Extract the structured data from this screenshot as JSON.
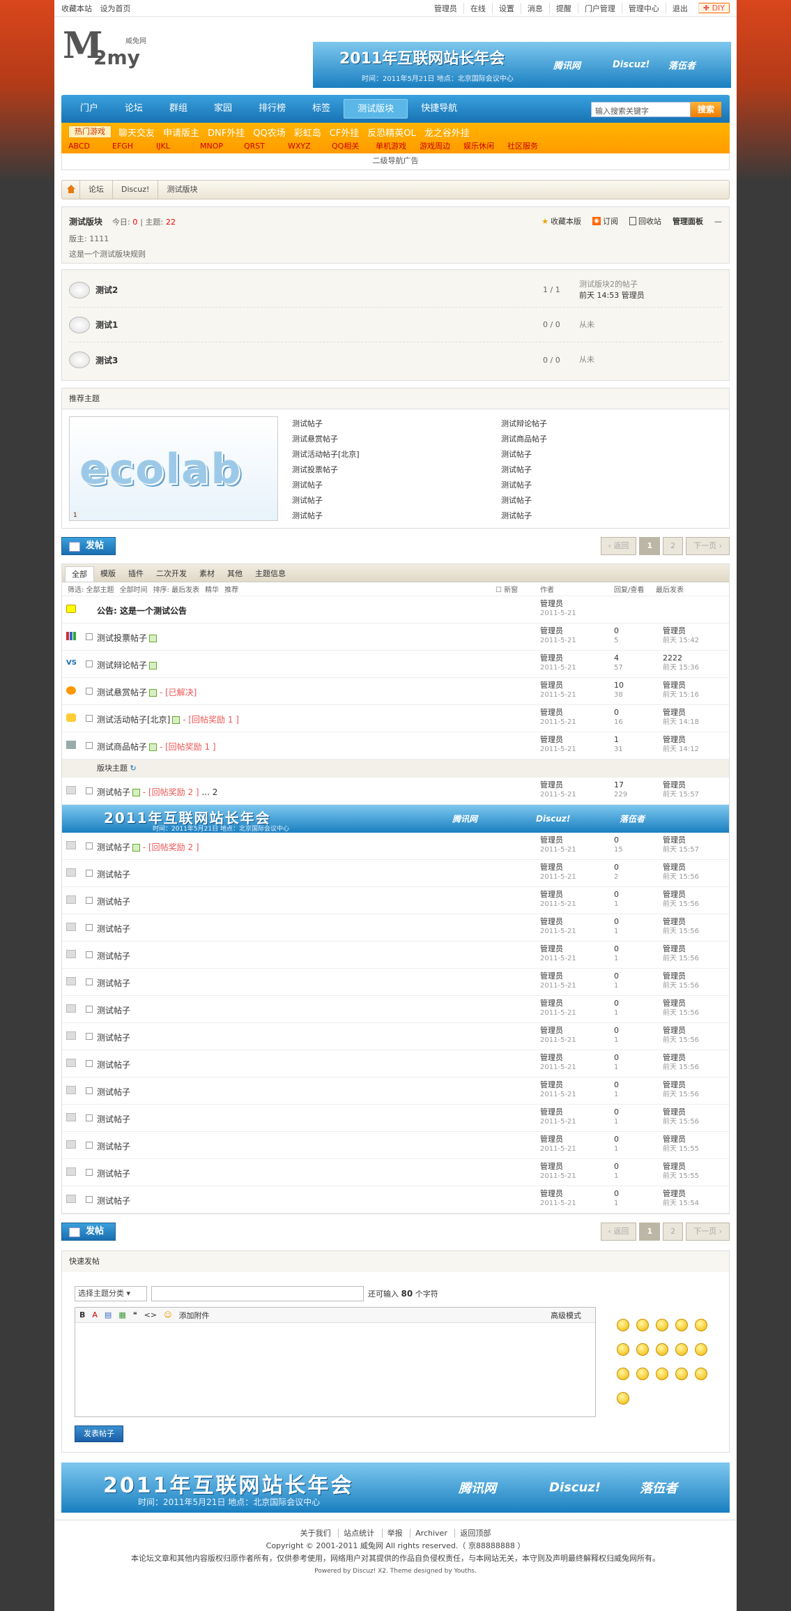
{
  "topbar": {
    "left": [
      "收藏本站",
      "设为首页"
    ],
    "right": [
      "管理员",
      "在线",
      "设置",
      "消息",
      "提醒",
      "门户管理",
      "管理中心",
      "退出"
    ],
    "diy": "DIY"
  },
  "logo": {
    "text": "2my",
    "sub": "威兔网"
  },
  "header_banner": {
    "title": "2011年互联网站长年会",
    "subtitle": "时间：2011年5月21日    地点：北京国际会议中心",
    "logos": [
      "腾讯网",
      "Discuz!",
      "落伍者"
    ]
  },
  "nav": {
    "items": [
      "门户",
      "论坛",
      "群组",
      "家园",
      "排行榜",
      "标签",
      "测试版块",
      "快捷导航"
    ],
    "active_index": 6,
    "search_placeholder": "输入搜索关键字",
    "search_button": "搜索"
  },
  "hotgames": {
    "label": "热门游戏",
    "links": [
      "聊天交友",
      "申请版主",
      "DNF外挂",
      "QQ农场",
      "彩虹岛",
      "CF外挂",
      "反恐精英OL",
      "龙之谷外挂"
    ],
    "sublinks": [
      "ABCD",
      "EFGH",
      "IJKL",
      "MNOP",
      "QRST",
      "WXYZ",
      "QQ相关",
      "单机游戏",
      "游戏周边",
      "娱乐休闲",
      "社区服务"
    ]
  },
  "secondary_ad": "二级导航广告",
  "breadcrumb": [
    "论坛",
    "Discuz!",
    "测试版块"
  ],
  "forum": {
    "name": "测试版块",
    "today_label": "今日:",
    "today": "0",
    "threads_label": "主题:",
    "threads": "22",
    "moderator": "版主: 1111",
    "rules": "这是一个测试版块规则",
    "tools": [
      "收藏本版",
      "订阅",
      "回收站",
      "管理面板"
    ]
  },
  "subforums": [
    {
      "name": "测试2",
      "count": "1 / 1",
      "last_title": "测试版块2的帖子",
      "last_time": "前天 14:53",
      "last_user": "管理员"
    },
    {
      "name": "测试1",
      "count": "0 / 0",
      "last_title": "从未",
      "last_time": "",
      "last_user": ""
    },
    {
      "name": "测试3",
      "count": "0 / 0",
      "last_title": "从未",
      "last_time": "",
      "last_user": ""
    }
  ],
  "recommended": {
    "title": "推荐主题",
    "pic_text": "ecolab",
    "pic_num": "1",
    "col1": [
      "测试帖子",
      "测试悬赏帖子",
      "测试活动帖子[北京]",
      "测试投票帖子",
      "测试帖子",
      "测试帖子",
      "测试帖子"
    ],
    "col2": [
      "测试辩论帖子",
      "测试商品帖子",
      "测试帖子",
      "测试帖子",
      "测试帖子",
      "测试帖子",
      "测试帖子"
    ]
  },
  "actions": {
    "post": "发帖",
    "pager_prev": "返回",
    "pages": [
      "1",
      "2"
    ],
    "pager_next": "下一页"
  },
  "tabs": [
    "全部",
    "模版",
    "插件",
    "二次开发",
    "素材",
    "其他",
    "主题信息"
  ],
  "filter": {
    "items": [
      "筛选: 全部主题",
      "全部时间",
      "排序: 最后发表",
      "精华",
      "推荐"
    ],
    "new_label": "新窗",
    "col_author": "作者",
    "col_replies": "回复/查看",
    "col_last": "最后发表"
  },
  "announcement": {
    "title": "公告: 这是一个测试公告",
    "author": "管理员",
    "date": "2011-5-21"
  },
  "top_threads": [
    {
      "icon": "poll-icon",
      "title": "测试投票帖子",
      "extra": "",
      "author": "管理员",
      "date": "2011-5-21",
      "replies": "0",
      "views": "5",
      "last_user": "管理员",
      "last_time": "前天 15:42"
    },
    {
      "icon": "debate-icon",
      "title": "测试辩论帖子",
      "extra": "",
      "author": "管理员",
      "date": "2011-5-21",
      "replies": "4",
      "views": "57",
      "last_user": "2222",
      "last_time": "前天 15:36"
    },
    {
      "icon": "reward-icon",
      "title": "测试悬赏帖子",
      "extra": "- [已解决]",
      "author": "管理员",
      "date": "2011-5-21",
      "replies": "10",
      "views": "38",
      "last_user": "管理员",
      "last_time": "前天 15:16"
    },
    {
      "icon": "activity-icon",
      "title": "测试活动帖子[北京]",
      "extra": "- [回帖奖励 1 ]",
      "author": "管理员",
      "date": "2011-5-21",
      "replies": "0",
      "views": "16",
      "last_user": "管理员",
      "last_time": "前天 14:18"
    },
    {
      "icon": "trade-icon",
      "title": "测试商品帖子",
      "extra": "- [回帖奖励 1 ]",
      "author": "管理员",
      "date": "2011-5-21",
      "replies": "1",
      "views": "31",
      "last_user": "管理员",
      "last_time": "前天 14:12"
    }
  ],
  "section_label": "版块主题",
  "first_normal": {
    "title": "测试帖子",
    "extra": "- [回帖奖励 2 ]",
    "pages": "... 2",
    "author": "管理员",
    "date": "2011-5-21",
    "replies": "17",
    "views": "229",
    "last_user": "管理员",
    "last_time": "前天 15:57"
  },
  "list_ad": {
    "title": "2011年互联网站长年会",
    "subtitle": "时间：2011年5月21日    地点：北京国际会议中心"
  },
  "threads": [
    {
      "title": "测试帖子",
      "extra": "- [回帖奖励 2 ]",
      "author": "管理员",
      "date": "2011-5-21",
      "replies": "0",
      "views": "15",
      "last_user": "管理员",
      "last_time": "前天 15:57"
    },
    {
      "title": "测试帖子",
      "extra": "",
      "author": "管理员",
      "date": "2011-5-21",
      "replies": "0",
      "views": "2",
      "last_user": "管理员",
      "last_time": "前天 15:56"
    },
    {
      "title": "测试帖子",
      "extra": "",
      "author": "管理员",
      "date": "2011-5-21",
      "replies": "0",
      "views": "1",
      "last_user": "管理员",
      "last_time": "前天 15:56"
    },
    {
      "title": "测试帖子",
      "extra": "",
      "author": "管理员",
      "date": "2011-5-21",
      "replies": "0",
      "views": "1",
      "last_user": "管理员",
      "last_time": "前天 15:56"
    },
    {
      "title": "测试帖子",
      "extra": "",
      "author": "管理员",
      "date": "2011-5-21",
      "replies": "0",
      "views": "1",
      "last_user": "管理员",
      "last_time": "前天 15:56"
    },
    {
      "title": "测试帖子",
      "extra": "",
      "author": "管理员",
      "date": "2011-5-21",
      "replies": "0",
      "views": "1",
      "last_user": "管理员",
      "last_time": "前天 15:56"
    },
    {
      "title": "测试帖子",
      "extra": "",
      "author": "管理员",
      "date": "2011-5-21",
      "replies": "0",
      "views": "1",
      "last_user": "管理员",
      "last_time": "前天 15:56"
    },
    {
      "title": "测试帖子",
      "extra": "",
      "author": "管理员",
      "date": "2011-5-21",
      "replies": "0",
      "views": "1",
      "last_user": "管理员",
      "last_time": "前天 15:56"
    },
    {
      "title": "测试帖子",
      "extra": "",
      "author": "管理员",
      "date": "2011-5-21",
      "replies": "0",
      "views": "1",
      "last_user": "管理员",
      "last_time": "前天 15:56"
    },
    {
      "title": "测试帖子",
      "extra": "",
      "author": "管理员",
      "date": "2011-5-21",
      "replies": "0",
      "views": "1",
      "last_user": "管理员",
      "last_time": "前天 15:56"
    },
    {
      "title": "测试帖子",
      "extra": "",
      "author": "管理员",
      "date": "2011-5-21",
      "replies": "0",
      "views": "1",
      "last_user": "管理员",
      "last_time": "前天 15:56"
    },
    {
      "title": "测试帖子",
      "extra": "",
      "author": "管理员",
      "date": "2011-5-21",
      "replies": "0",
      "views": "1",
      "last_user": "管理员",
      "last_time": "前天 15:55"
    },
    {
      "title": "测试帖子",
      "extra": "",
      "author": "管理员",
      "date": "2011-5-21",
      "replies": "0",
      "views": "1",
      "last_user": "管理员",
      "last_time": "前天 15:55"
    },
    {
      "title": "测试帖子",
      "extra": "",
      "author": "管理员",
      "date": "2011-5-21",
      "replies": "0",
      "views": "1",
      "last_user": "管理员",
      "last_time": "前天 15:54"
    }
  ],
  "quick_post": {
    "title": "快速发帖",
    "type_select": "选择主题分类",
    "hint_prefix": "还可输入",
    "hint_count": "80",
    "hint_suffix": "个字符",
    "toolbar": [
      "B",
      "A",
      "▤",
      "▦",
      "❝",
      "<>",
      "☺"
    ],
    "attach": "添加附件",
    "advanced": "高级模式",
    "submit": "发表帖子"
  },
  "footer_banner": {
    "title": "2011年互联网站长年会",
    "subtitle": "时间：2011年5月21日    地点：北京国际会议中心",
    "logos": [
      "腾讯网",
      "Discuz!",
      "落伍者"
    ]
  },
  "footer": {
    "links": [
      "关于我们",
      "站点统计",
      "举报",
      "Archiver",
      "返回顶部"
    ],
    "copyright": "Copyright © 2001-2011 威兔网 All rights reserved.（ 京88888888 ）",
    "disclaimer": "本论坛文章和其他内容版权归原作者所有，仅供参考使用，网络用户对其提供的作品自负侵权责任，与本网站无关，本守则及声明最终解释权归威兔网所有。",
    "powered": "Powered by Discuz! X2.  Theme designed by Youths."
  },
  "colors": {
    "nav_blue": "#1872b3",
    "hot_orange": "#ff9b00",
    "accent_red": "#e00"
  }
}
